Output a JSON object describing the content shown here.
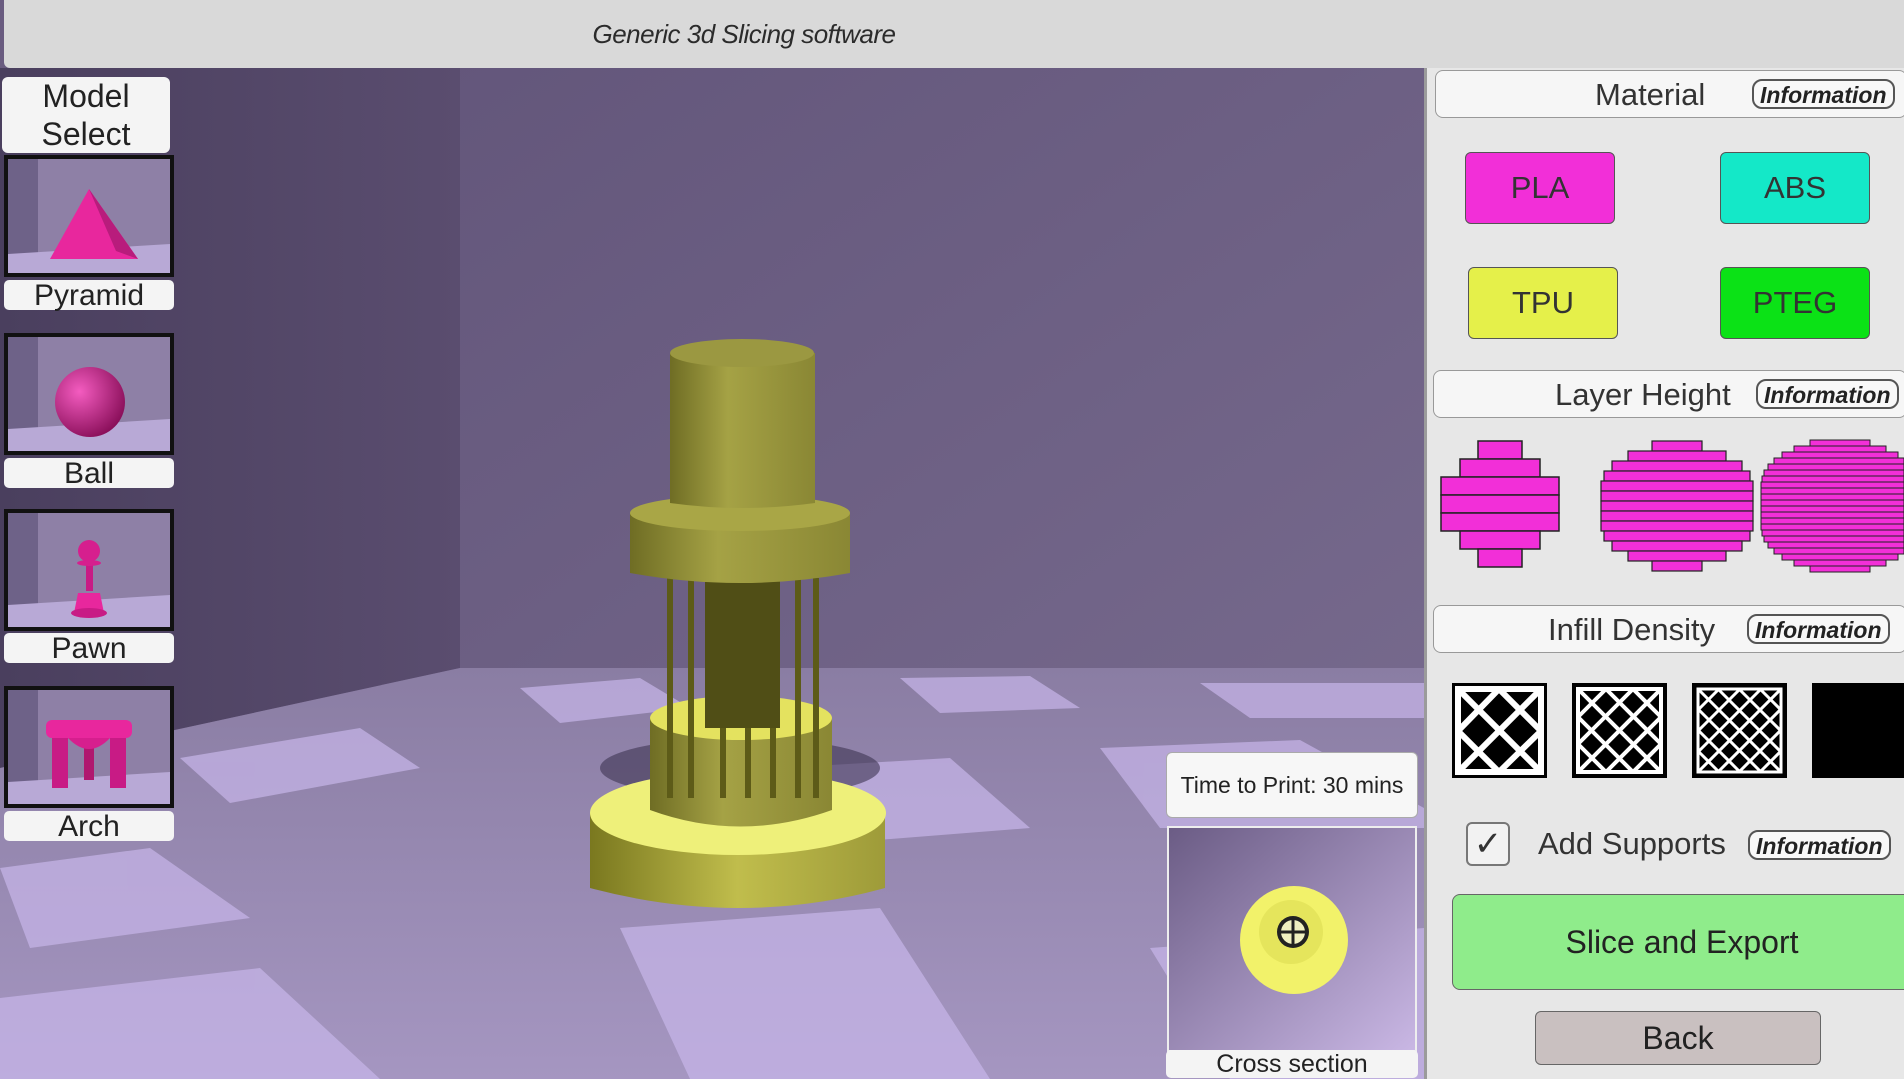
{
  "app": {
    "title": "Generic 3d Slicing software"
  },
  "model_select": {
    "header": "Model Select",
    "models": [
      {
        "label": "Pyramid",
        "icon": "pyramid-icon"
      },
      {
        "label": "Ball",
        "icon": "ball-icon"
      },
      {
        "label": "Pawn",
        "icon": "pawn-icon"
      },
      {
        "label": "Arch",
        "icon": "arch-icon"
      }
    ]
  },
  "viewport": {
    "time_to_print": "Time to Print: 30 mins",
    "cross_section_label": "Cross section"
  },
  "panel": {
    "material": {
      "title": "Material",
      "info": "Information",
      "options": [
        {
          "label": "PLA",
          "color": "#f22fd8"
        },
        {
          "label": "ABS",
          "color": "#14e8c8"
        },
        {
          "label": "TPU",
          "color": "#e5f04a"
        },
        {
          "label": "PTEG",
          "color": "#0be216"
        }
      ]
    },
    "layer_height": {
      "title": "Layer Height",
      "info": "Information",
      "accent": "#f22fd8"
    },
    "infill_density": {
      "title": "Infill Density",
      "info": "Information"
    },
    "supports": {
      "label": "Add Supports",
      "info": "Information",
      "checked": true,
      "check_glyph": "✓"
    },
    "slice_button": "Slice and Export",
    "back_button": "Back"
  }
}
